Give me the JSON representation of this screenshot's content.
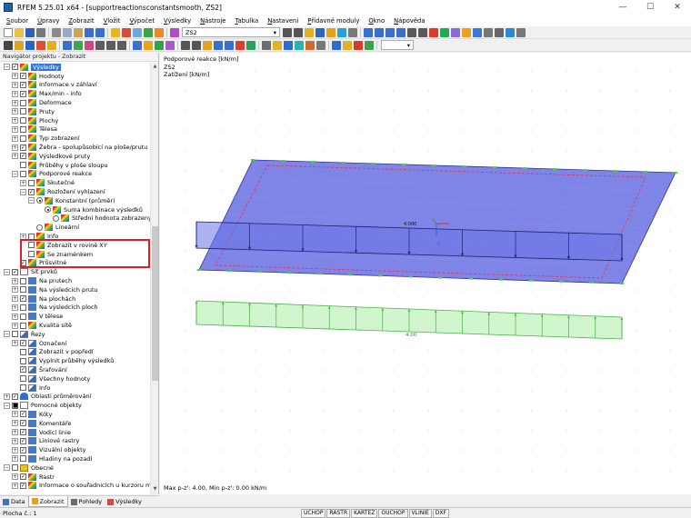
{
  "window": {
    "title": "RFEM 5.25.01 x64 - [supportreactionsconstantsmooth, ZS2]",
    "minimize": "—",
    "maximize": "☐",
    "close": "✕"
  },
  "menu": [
    "Soubor",
    "Úpravy",
    "Zobrazit",
    "Vložit",
    "Výpočet",
    "Výsledky",
    "Nástroje",
    "Tabulka",
    "Nastavení",
    "Přídavné moduly",
    "Okno",
    "Nápověda"
  ],
  "toolbar": {
    "load_case_code": "ZS2",
    "right_combo_value": ""
  },
  "navigator": {
    "title": "Navigátor projektu - Zobrazit",
    "tree": [
      {
        "label": "Výsledky",
        "selected": true
      },
      {
        "label": "Hodnoty"
      },
      {
        "label": "Informace v záhlaví"
      },
      {
        "label": "Max/min - info"
      },
      {
        "label": "Deformace"
      },
      {
        "label": "Pruty"
      },
      {
        "label": "Plochy"
      },
      {
        "label": "Tělesa"
      },
      {
        "label": "Typ zobrazení"
      },
      {
        "label": "Žebra - spolupůsobící na ploše/prutu"
      },
      {
        "label": "Výsledkové pruty"
      },
      {
        "label": "Průběhy v ploše sloupu"
      },
      {
        "label": "Podporové reakce"
      },
      {
        "label": "Skutečné"
      },
      {
        "label": "Rozložení vyhlazení"
      },
      {
        "label": "Konstantní (průměr)"
      },
      {
        "label": "Suma kombinace výsledků"
      },
      {
        "label": "Střední hodnota zobrazených"
      },
      {
        "label": "Lineární"
      },
      {
        "label": "Info"
      },
      {
        "label": "Zobrazit v rovině XY"
      },
      {
        "label": "Se znaménkem"
      },
      {
        "label": "Průsvitné"
      },
      {
        "label": "Síť prvků"
      },
      {
        "label": "Na prutech"
      },
      {
        "label": "Na výsledcích prutu"
      },
      {
        "label": "Na plochách"
      },
      {
        "label": "Na výsledcích ploch"
      },
      {
        "label": "V tělese"
      },
      {
        "label": "Kvalita sítě"
      },
      {
        "label": "Řezy"
      },
      {
        "label": "Označení"
      },
      {
        "label": "Zobrazit v popředí"
      },
      {
        "label": "Vyplnit průběhy výsledků"
      },
      {
        "label": "Šrafování"
      },
      {
        "label": "Všechny hodnoty"
      },
      {
        "label": "Info"
      },
      {
        "label": "Oblasti průměrování"
      },
      {
        "label": "Pomocné objekty"
      },
      {
        "label": "Kóty"
      },
      {
        "label": "Komentáře"
      },
      {
        "label": "Vodicí linie"
      },
      {
        "label": "Liniové rastry"
      },
      {
        "label": "Vizuální objekty"
      },
      {
        "label": "Hladiny na pozadí"
      },
      {
        "label": "Obecné"
      },
      {
        "label": "Rastr"
      },
      {
        "label": "Informace o souřadnicích u kurzoru myši"
      }
    ],
    "tabs": [
      "Data",
      "Zobrazit",
      "Pohledy",
      "Výsledky"
    ]
  },
  "viewport": {
    "info_lines": [
      "Podporové reakce [kN/m]",
      "ZS2",
      "Zatížení [kN/m]"
    ],
    "footer": "Max p-z': 4.00, Min p-z': 0.00 kN/m",
    "load_value_label": "4.000",
    "reaction_value_label": "4.00",
    "axis_z_label": "Z"
  },
  "statusbar": {
    "text": "Plocha č.: 1",
    "buttons": [
      "UCHOP",
      "RASTR",
      "KARTEZ",
      "OUCHOP",
      "VLINIE",
      "DXF"
    ]
  },
  "colors": {
    "plate_fill": "#5b63e0",
    "reaction_fill": "#c9f5c4",
    "reaction_stroke": "#48b048",
    "selection": "#3377d6",
    "highlight": "#d8202a"
  }
}
